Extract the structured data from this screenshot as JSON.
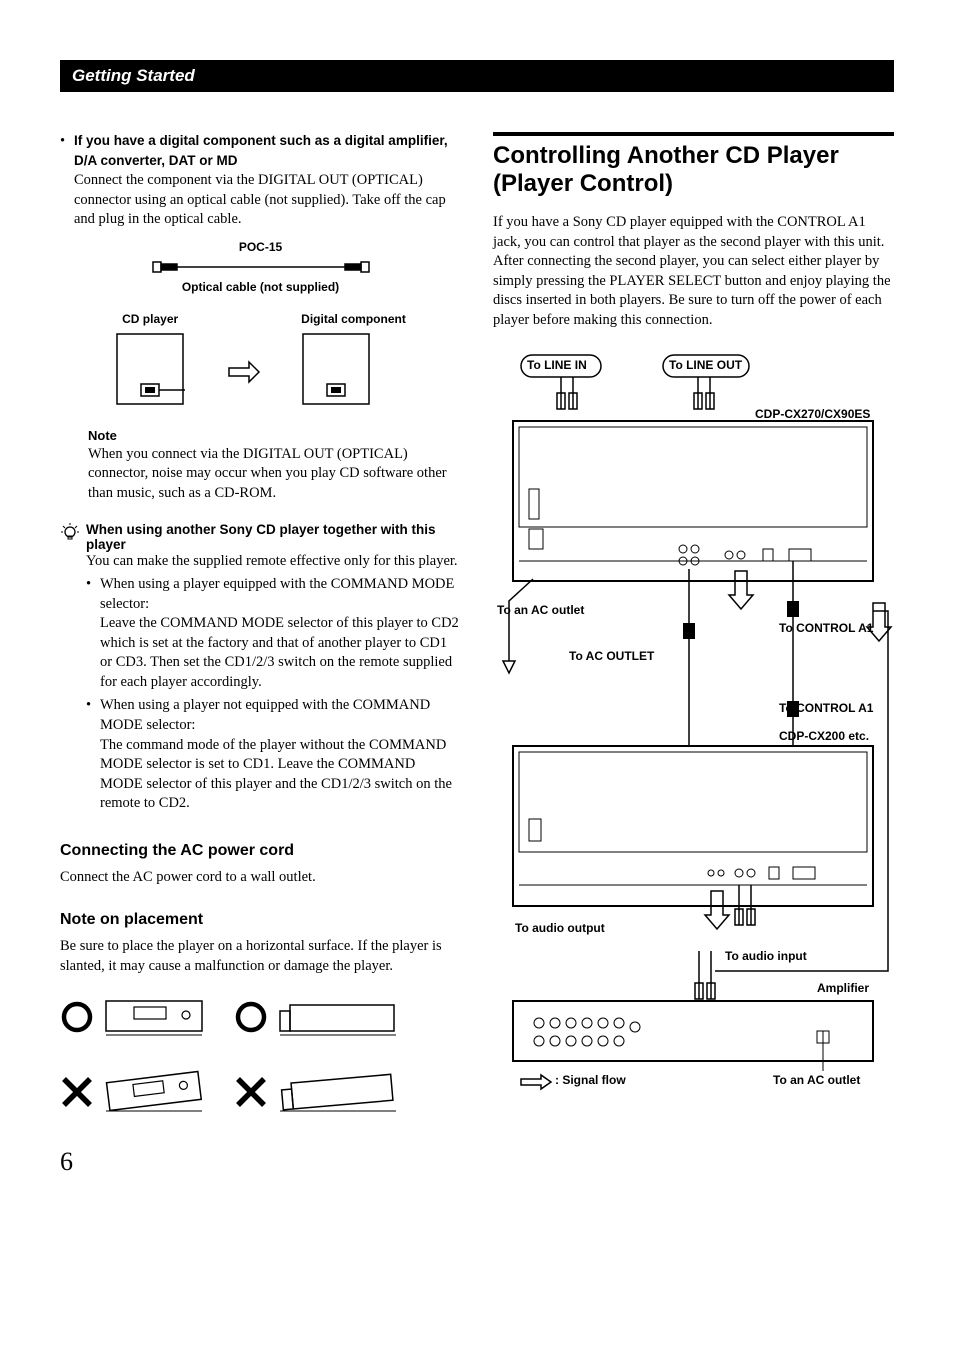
{
  "header": {
    "title": "Getting Started"
  },
  "left": {
    "digital": {
      "bullet_heading": "If you have a digital component such as a digital amplifier, D/A converter, DAT or MD",
      "body": "Connect the component via the DIGITAL OUT (OPTICAL) connector using an optical cable (not supplied). Take off the cap and plug in the optical cable.",
      "cable_name": "POC-15",
      "cable_note": "Optical cable (not supplied)",
      "label_cd": "CD player",
      "label_digital": "Digital component"
    },
    "note": {
      "label": "Note",
      "body": "When you connect via the DIGITAL OUT (OPTICAL) connector, noise may occur when you play CD software other than music, such as a CD-ROM."
    },
    "tip": {
      "heading": "When using another Sony CD player together with this player",
      "intro": "You can make the supplied remote effective only for this player.",
      "item1_lead": "When using a player equipped with the COMMAND MODE selector:",
      "item1_body": "Leave the COMMAND MODE selector of this player to CD2 which is set at the factory and that of another player to CD1 or CD3. Then set the CD1/2/3 switch on the remote supplied for each player accordingly.",
      "item2_lead": "When using a player not equipped with the COMMAND MODE selector:",
      "item2_body": "The command mode of the player without the COMMAND MODE selector is set to CD1. Leave the COMMAND MODE selector of this player and the CD1/2/3 switch on the remote to CD2."
    },
    "ac": {
      "heading": "Connecting the AC power cord",
      "body": "Connect the AC power cord to a wall outlet."
    },
    "placement": {
      "heading": "Note on placement",
      "body": "Be sure to place the player on a horizontal surface. If the player is slanted, it may cause a malfunction or damage the player."
    }
  },
  "right": {
    "heading": "Controlling Another CD Player (Player Control)",
    "intro": "If you have a Sony CD player equipped with the CONTROL A1 jack, you can control that player as the second player with this unit. After connecting the second player, you can select either player by simply pressing the PLAYER SELECT button and enjoy playing the discs inserted in both players. Be sure to turn off the power of each player before making this connection.",
    "labels": {
      "line_in": "To LINE IN",
      "line_out": "To LINE OUT",
      "model1": "CDP-CX270/CX90ES",
      "ac_outlet_small": "To an AC outlet",
      "ac_outlet_upper": "To AC OUTLET",
      "control_a1": "To CONTROL A1",
      "model2": "CDP-CX200 etc.",
      "audio_output": "To audio output",
      "audio_input": "To audio input",
      "amplifier": "Amplifier",
      "signal_flow": ": Signal flow",
      "to_ac_outlet_bottom": "To an AC outlet"
    }
  },
  "page_number": "6"
}
